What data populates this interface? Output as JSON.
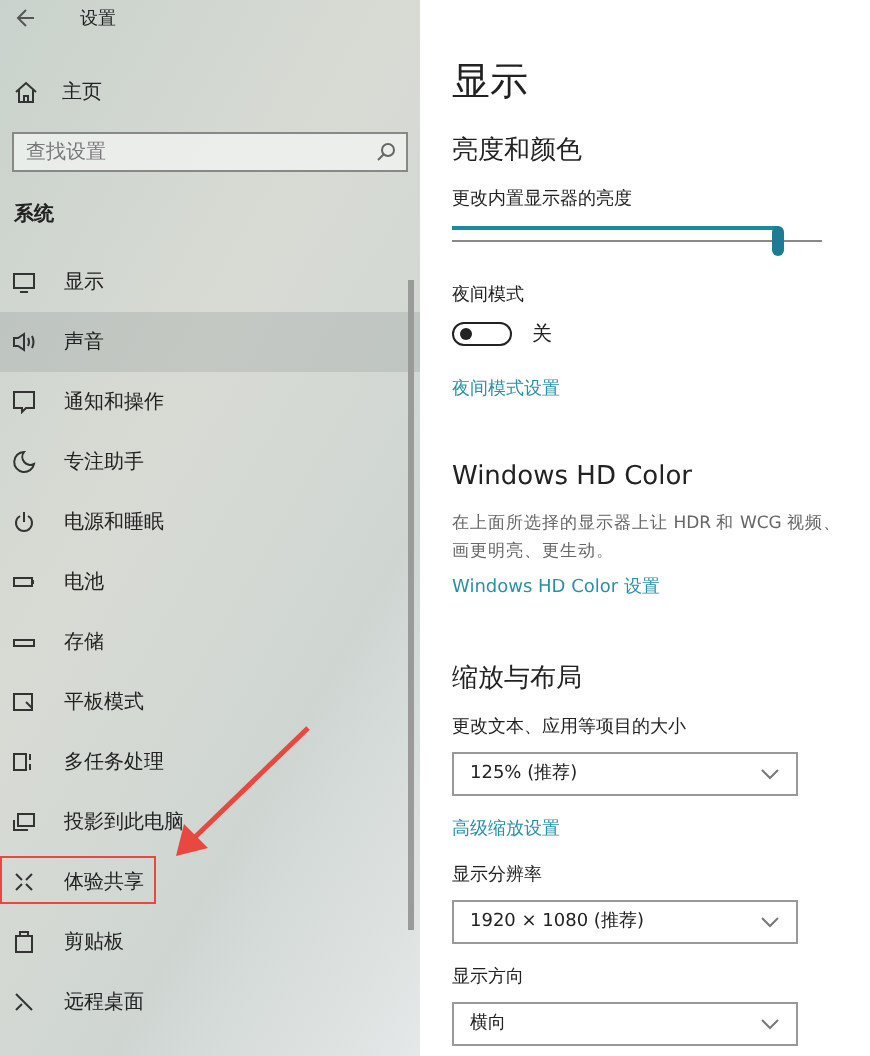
{
  "window": {
    "title": "设置"
  },
  "sidebar": {
    "home": "主页",
    "search": {
      "placeholder": "查找设置"
    },
    "section": "系统",
    "items": [
      {
        "label": "显示",
        "selected": false,
        "annotated": false
      },
      {
        "label": "声音",
        "selected": true,
        "annotated": false
      },
      {
        "label": "通知和操作",
        "selected": false,
        "annotated": false
      },
      {
        "label": "专注助手",
        "selected": false,
        "annotated": false
      },
      {
        "label": "电源和睡眠",
        "selected": false,
        "annotated": false
      },
      {
        "label": "电池",
        "selected": false,
        "annotated": false
      },
      {
        "label": "存储",
        "selected": false,
        "annotated": false
      },
      {
        "label": "平板模式",
        "selected": false,
        "annotated": false
      },
      {
        "label": "多任务处理",
        "selected": false,
        "annotated": false
      },
      {
        "label": "投影到此电脑",
        "selected": false,
        "annotated": false
      },
      {
        "label": "体验共享",
        "selected": false,
        "annotated": true
      },
      {
        "label": "剪贴板",
        "selected": false,
        "annotated": false
      },
      {
        "label": "远程桌面",
        "selected": false,
        "annotated": false
      }
    ]
  },
  "main": {
    "title": "显示",
    "sections": [
      {
        "heading": "亮度和颜色",
        "rows": [
          {
            "kind": "slider",
            "label": "更改内置显示器的亮度",
            "level": 0.88
          },
          {
            "kind": "toggle",
            "label": "夜间模式",
            "on": false,
            "state": "关"
          },
          {
            "kind": "link",
            "text": "夜间模式设置"
          }
        ]
      },
      {
        "heading": "Windows HD Color",
        "rows": [
          {
            "kind": "text",
            "text": "在上面所选择的显示器上让 HDR 和 WCG 视频、画更明亮、更生动。"
          },
          {
            "kind": "link",
            "text": "Windows HD Color 设置"
          }
        ]
      },
      {
        "heading": "缩放与布局",
        "rows": [
          {
            "kind": "dropdown",
            "label": "更改文本、应用等项目的大小",
            "value": "125% (推荐)"
          },
          {
            "kind": "link",
            "text": "高级缩放设置"
          },
          {
            "kind": "dropdown",
            "label": "显示分辨率",
            "value": "1920 × 1080 (推荐)"
          },
          {
            "kind": "dropdown",
            "label": "显示方向",
            "value": "横向"
          }
        ]
      }
    ]
  }
}
